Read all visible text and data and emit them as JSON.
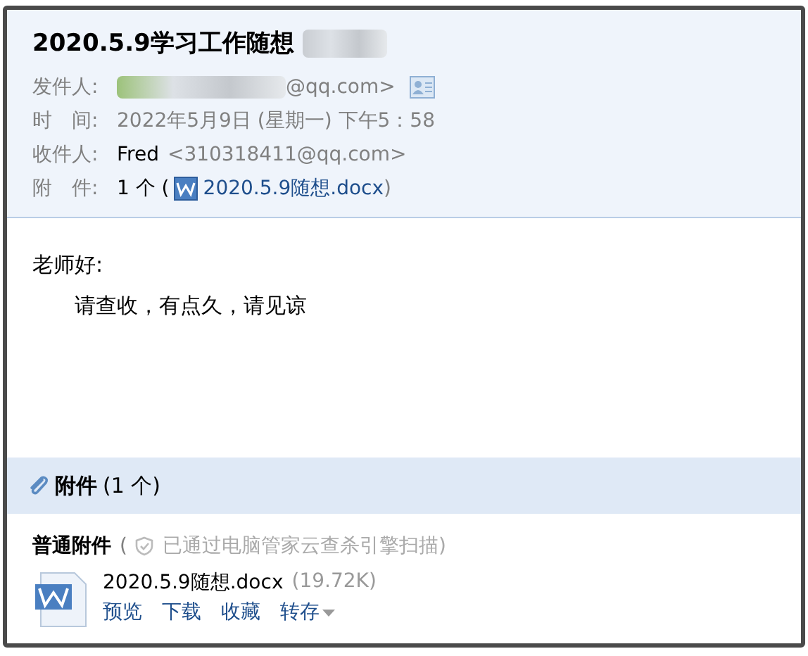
{
  "subject": "2020.5.9学习工作随想",
  "header_fields": [
    {
      "kind": "sender",
      "label": "发件人:",
      "value": "@qq.com>"
    },
    {
      "kind": "plain",
      "label": "时　间:",
      "value": "2022年5月9日 (星期一) 下午5：58"
    },
    {
      "kind": "recipient",
      "label": "收件人:",
      "name": "Fred",
      "value": "<310318411@qq.com>"
    },
    {
      "kind": "attachment",
      "label": "附　件:",
      "count": "1 个 (",
      "file": "2020.5.9随想.docx",
      "close": ")"
    }
  ],
  "body": [
    "老师好:",
    "请查收，有点久，请见谅"
  ],
  "attachments_bar": {
    "title": "附件",
    "count": "(1 个)"
  },
  "section": {
    "title": "普通附件",
    "scan_open": "(",
    "scan_text": "已通过电脑管家云查杀引擎扫描)"
  },
  "file": {
    "name": "2020.5.9随想.docx",
    "size": "(19.72K)",
    "actions": [
      "预览",
      "下载",
      "收藏",
      "转存"
    ]
  }
}
